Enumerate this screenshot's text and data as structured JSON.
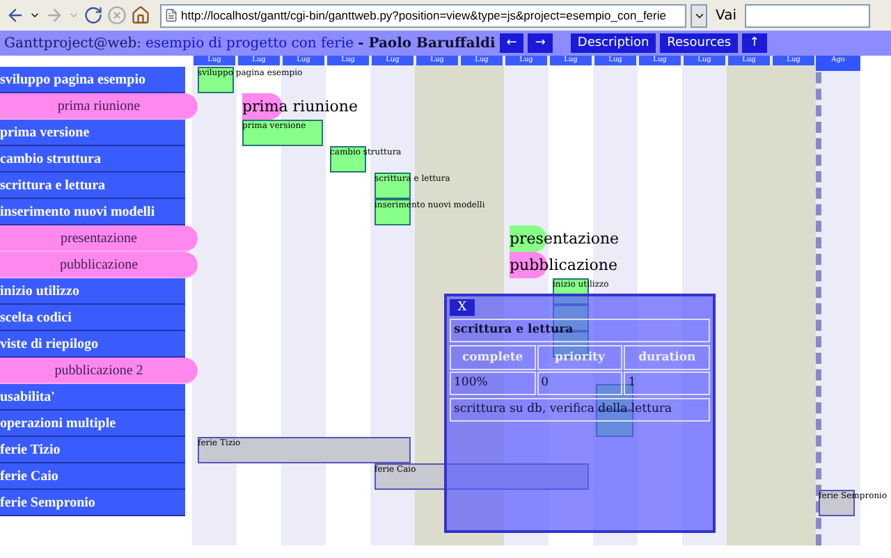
{
  "browser": {
    "url": "http://localhost/gantt/cgi-bin/ganttweb.py?position=view&type=js&project=esempio_con_ferie",
    "go_label": "Vai"
  },
  "header": {
    "app": "Ganttproject@web:",
    "project_link": "esempio di progetto con ferie",
    "author": "- Paolo Baruffaldi",
    "nav_buttons": [
      "←",
      "→",
      "Description",
      "Resources",
      "↑"
    ]
  },
  "timeline": {
    "columns": [
      {
        "label": "Lug",
        "kind": "shaded"
      },
      {
        "label": "Lug",
        "kind": "plain"
      },
      {
        "label": "Lug",
        "kind": "shaded"
      },
      {
        "label": "Lug",
        "kind": "plain"
      },
      {
        "label": "Lug",
        "kind": "shaded"
      },
      {
        "label": "Lug",
        "kind": "weekend"
      },
      {
        "label": "Lug",
        "kind": "weekend"
      },
      {
        "label": "Lug",
        "kind": "shaded"
      },
      {
        "label": "Lug",
        "kind": "plain"
      },
      {
        "label": "Lug",
        "kind": "shaded"
      },
      {
        "label": "Lug",
        "kind": "plain"
      },
      {
        "label": "Lug",
        "kind": "shaded"
      },
      {
        "label": "Lug",
        "kind": "weekend"
      },
      {
        "label": "Lug",
        "kind": "weekend"
      },
      {
        "label": "Ago",
        "kind": "today"
      }
    ]
  },
  "tasks": [
    {
      "name": "sviluppo pagina esempio",
      "kind": "task",
      "bar_label": "sviluppo pagina esempio"
    },
    {
      "name": "prima riunione",
      "kind": "milestone",
      "color": "#ff88ee",
      "bar_label": "prima riunione"
    },
    {
      "name": "prima versione",
      "kind": "task",
      "bar_label": "prima versione"
    },
    {
      "name": "cambio struttura",
      "kind": "task",
      "bar_label": "cambio struttura"
    },
    {
      "name": "scrittura e lettura",
      "kind": "task",
      "bar_label": "scrittura e lettura"
    },
    {
      "name": "inserimento nuovi modelli",
      "kind": "task",
      "bar_label": "inserimento nuovi modelli"
    },
    {
      "name": "presentazione",
      "kind": "milestone",
      "color": "#88ff88",
      "bar_label": "presentazione"
    },
    {
      "name": "pubblicazione",
      "kind": "milestone",
      "color": "#ff88ee",
      "bar_label": "pubblicazione"
    },
    {
      "name": "inizio utilizzo",
      "kind": "task",
      "bar_label": "inizio utilizzo"
    },
    {
      "name": "scelta codici",
      "kind": "task"
    },
    {
      "name": "viste di riepilogo",
      "kind": "task"
    },
    {
      "name": "pubblicazione 2",
      "kind": "milestone"
    },
    {
      "name": "usabilita'",
      "kind": "task"
    },
    {
      "name": "operazioni multiple",
      "kind": "task"
    },
    {
      "name": "ferie Tizio",
      "kind": "vacation",
      "bar_label": "ferie Tizio"
    },
    {
      "name": "ferie Caio",
      "kind": "vacation",
      "bar_label": "ferie Caio"
    },
    {
      "name": "ferie Sempronio",
      "kind": "vacation",
      "bar_label": "ferie Sempronio"
    }
  ],
  "popup": {
    "close": "X",
    "title": "scrittura e lettura",
    "columns": [
      "complete",
      "priority",
      "duration"
    ],
    "values": [
      "100%",
      "0",
      "1"
    ],
    "notes": "scrittura su db, verifica della lettura"
  }
}
